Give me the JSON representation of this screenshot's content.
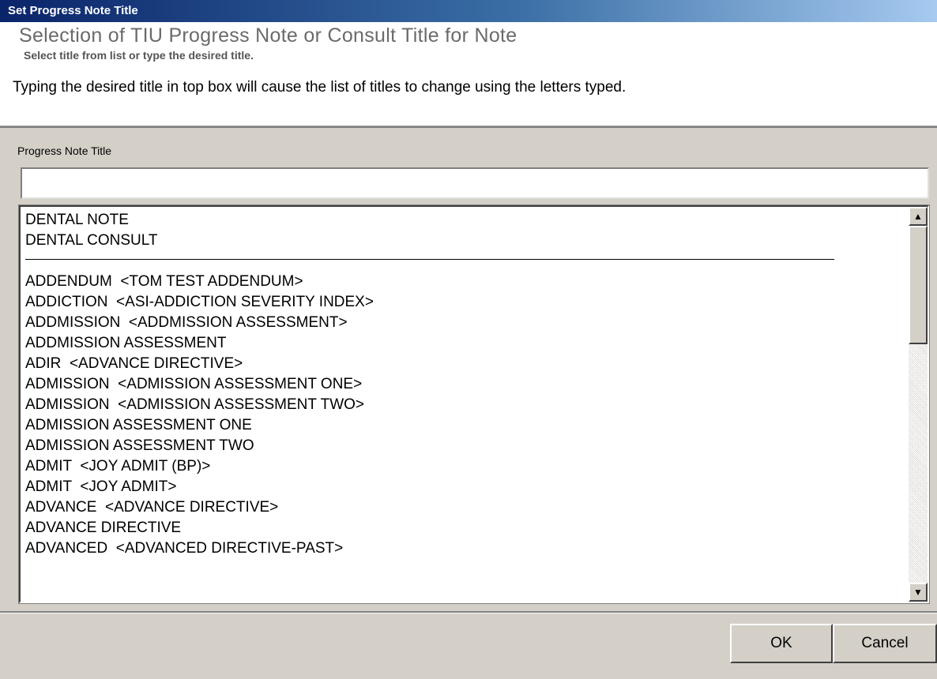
{
  "window": {
    "title": "Set Progress Note Title"
  },
  "header": {
    "heading": "Selection of TIU Progress Note or Consult Title for Note",
    "subheading": "Select title from list or type the desired title.",
    "instruction": "Typing the desired title in top box will cause the list of titles to change using the letters typed."
  },
  "form": {
    "field_label": "Progress Note Title",
    "input_value": ""
  },
  "list": {
    "pinned_items": [
      "DENTAL NOTE",
      "DENTAL CONSULT"
    ],
    "items": [
      "ADDENDUM  <TOM TEST ADDENDUM>",
      "ADDICTION  <ASI-ADDICTION SEVERITY INDEX>",
      "ADDMISSION  <ADDMISSION ASSESSMENT>",
      "ADDMISSION ASSESSMENT",
      "ADIR  <ADVANCE DIRECTIVE>",
      "ADMISSION  <ADMISSION ASSESSMENT ONE>",
      "ADMISSION  <ADMISSION ASSESSMENT TWO>",
      "ADMISSION ASSESSMENT ONE",
      "ADMISSION ASSESSMENT TWO",
      "ADMIT  <JOY ADMIT (BP)>",
      "ADMIT  <JOY ADMIT>",
      "ADVANCE  <ADVANCE DIRECTIVE>",
      "ADVANCE DIRECTIVE",
      "ADVANCED  <ADVANCED DIRECTIVE-PAST>"
    ],
    "scroll_up_glyph": "▲",
    "scroll_down_glyph": "▼"
  },
  "buttons": {
    "ok": "OK",
    "cancel": "Cancel"
  }
}
